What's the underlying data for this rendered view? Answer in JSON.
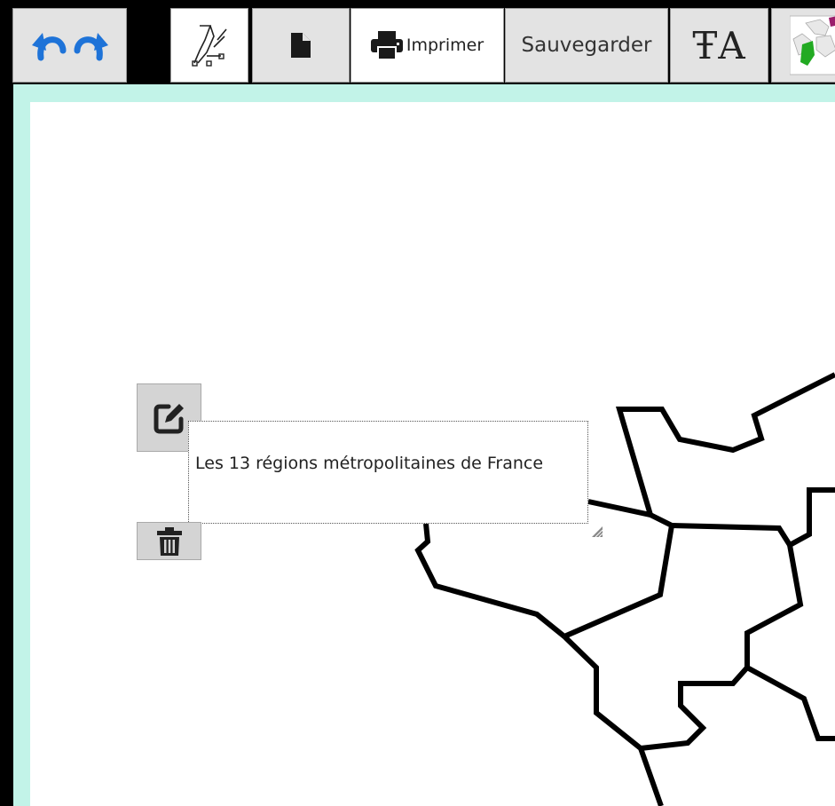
{
  "toolbar": {
    "undo_label": "",
    "redo_label": "",
    "print_label": "Imprimer",
    "save_label": "Sauvegarder",
    "text_tool_glyph": "ŦA",
    "icons": [
      "undo-icon",
      "redo-icon",
      "draw-tool-icon",
      "new-document-icon",
      "printer-icon",
      "text-size-icon",
      "map-thumbnail-icon"
    ],
    "undo_color": "#1e73d8"
  },
  "canvas": {
    "frame_color": "#c2f3e8",
    "text_box": {
      "text": "Les 13 régions métropolitaines de France"
    },
    "widgets": [
      "edit-icon",
      "trash-icon",
      "resize-handle-icon"
    ]
  }
}
